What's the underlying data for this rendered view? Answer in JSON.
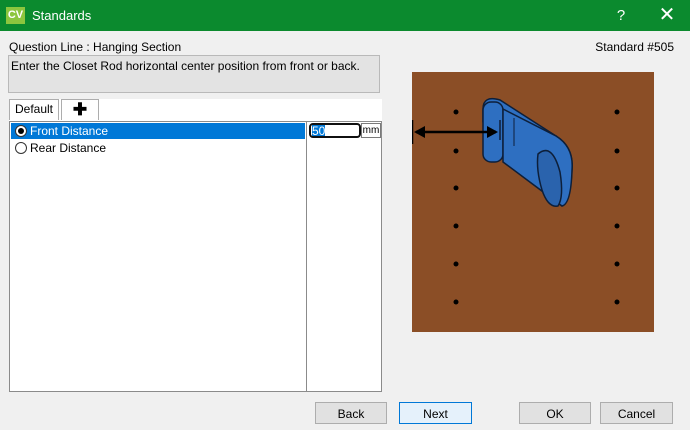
{
  "window": {
    "app_icon_text": "CV",
    "title": "Standards",
    "help_label": "?",
    "close_label": "✕"
  },
  "header": {
    "question_line": "Question Line : Hanging Section",
    "standard_number": "Standard #505",
    "description": "Enter the Closet Rod horizontal center position from front or back."
  },
  "tabs": [
    {
      "label": "Default",
      "selected": true
    },
    {
      "label": "✚",
      "selected": false
    }
  ],
  "options": [
    {
      "label": "Front Distance",
      "selected": true
    },
    {
      "label": "Rear Distance",
      "selected": false
    }
  ],
  "value_field": {
    "value": "50",
    "unit": "mm"
  },
  "buttons": {
    "back": "Back",
    "next": "Next",
    "ok": "OK",
    "cancel": "Cancel"
  },
  "colors": {
    "titlebar": "#0b8a2e",
    "panel_background": "#8b4e26",
    "rod": "#2e6fc1",
    "selection": "#0078d7"
  }
}
